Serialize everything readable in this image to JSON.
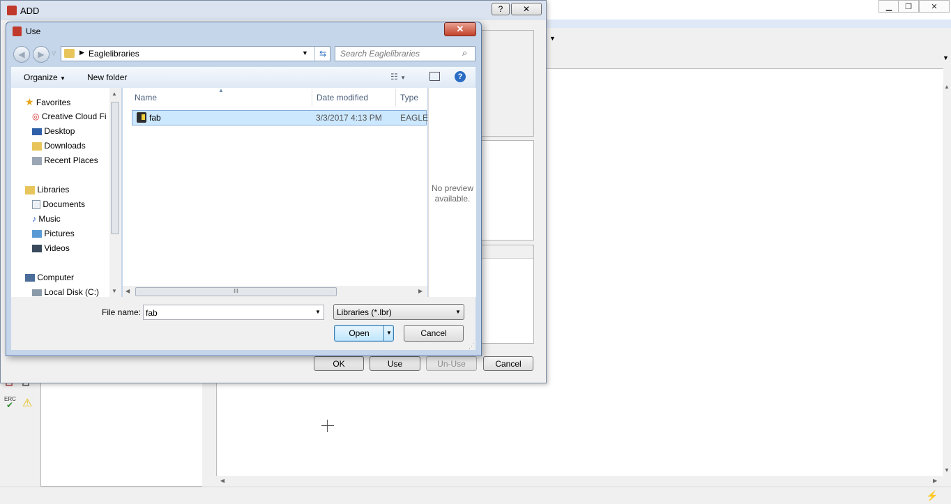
{
  "add_dialog": {
    "title": "ADD",
    "help_label": "?",
    "close_label": "✕",
    "buttons": {
      "ok": "OK",
      "use": "Use",
      "unuse": "Un-Use",
      "cancel": "Cancel"
    }
  },
  "use_dialog": {
    "title": "Use",
    "address": {
      "folder": "Eaglelibraries"
    },
    "search_placeholder": "Search Eaglelibraries",
    "toolbar": {
      "organize": "Organize",
      "new_folder": "New folder"
    },
    "nav": {
      "favorites": "Favorites",
      "favorites_items": [
        "Creative Cloud Fi",
        "Desktop",
        "Downloads",
        "Recent Places"
      ],
      "libraries": "Libraries",
      "libraries_items": [
        "Documents",
        "Music",
        "Pictures",
        "Videos"
      ],
      "computer": "Computer",
      "computer_items": [
        "Local Disk (C:)"
      ]
    },
    "columns": {
      "name": "Name",
      "date": "Date modified",
      "type": "Type"
    },
    "files": [
      {
        "name": "fab",
        "date": "3/3/2017 4:13 PM",
        "type": "EAGLE"
      }
    ],
    "preview": {
      "line1": "No preview",
      "line2": "available."
    },
    "file_name_label": "File name:",
    "file_name_value": "fab",
    "filter_value": "Libraries (*.lbr)",
    "open_label": "Open",
    "cancel_label": "Cancel",
    "hscroll_grip": "III"
  },
  "app": {
    "erc_label": "ERC",
    "colors": {
      "title_bar": "#dae3ef",
      "selected_row": "#cce8ff",
      "accent": "#3399ff"
    }
  }
}
